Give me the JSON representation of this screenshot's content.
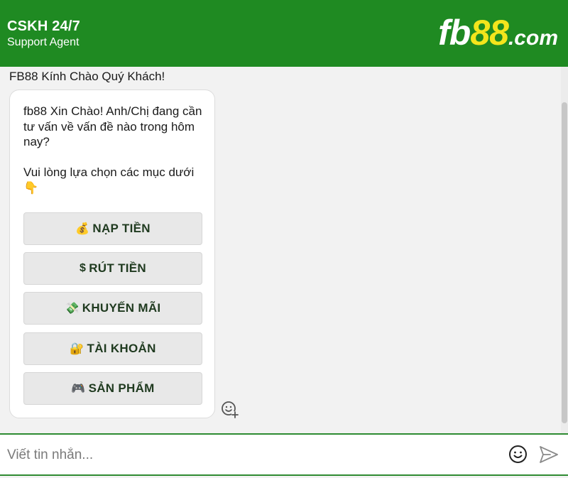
{
  "header": {
    "title": "CSKH 24/7",
    "subtitle": "Support Agent",
    "logo": {
      "part1": "fb",
      "part2": "88",
      "part3": ".com"
    }
  },
  "chat": {
    "greeting": "FB88 Kính Chào Quý Khách!",
    "bubble_text": "fb88 Xin Chào! Anh/Chị đang cần tư vấn về vấn đề nào trong hôm nay?\n\nVui lòng lựa chọn các mục dưới 👇",
    "options": [
      {
        "emoji": "💰",
        "label": "NẠP TIỀN"
      },
      {
        "emoji": "$",
        "label": "RÚT TIỀN"
      },
      {
        "emoji": "💸",
        "label": "KHUYẾN MÃI"
      },
      {
        "emoji": "🔐",
        "label": "TÀI KHOẢN"
      },
      {
        "emoji": "🎮",
        "label": "SẢN PHẨM"
      }
    ]
  },
  "input": {
    "placeholder": "Viết tin nhắn..."
  },
  "icons": {
    "react": "add-reaction-icon",
    "emoji": "smiley-icon",
    "send": "send-icon"
  },
  "colors": {
    "brand_green": "#1f8a22",
    "logo_yellow": "#f3e51c",
    "input_border": "#2e8b32"
  }
}
